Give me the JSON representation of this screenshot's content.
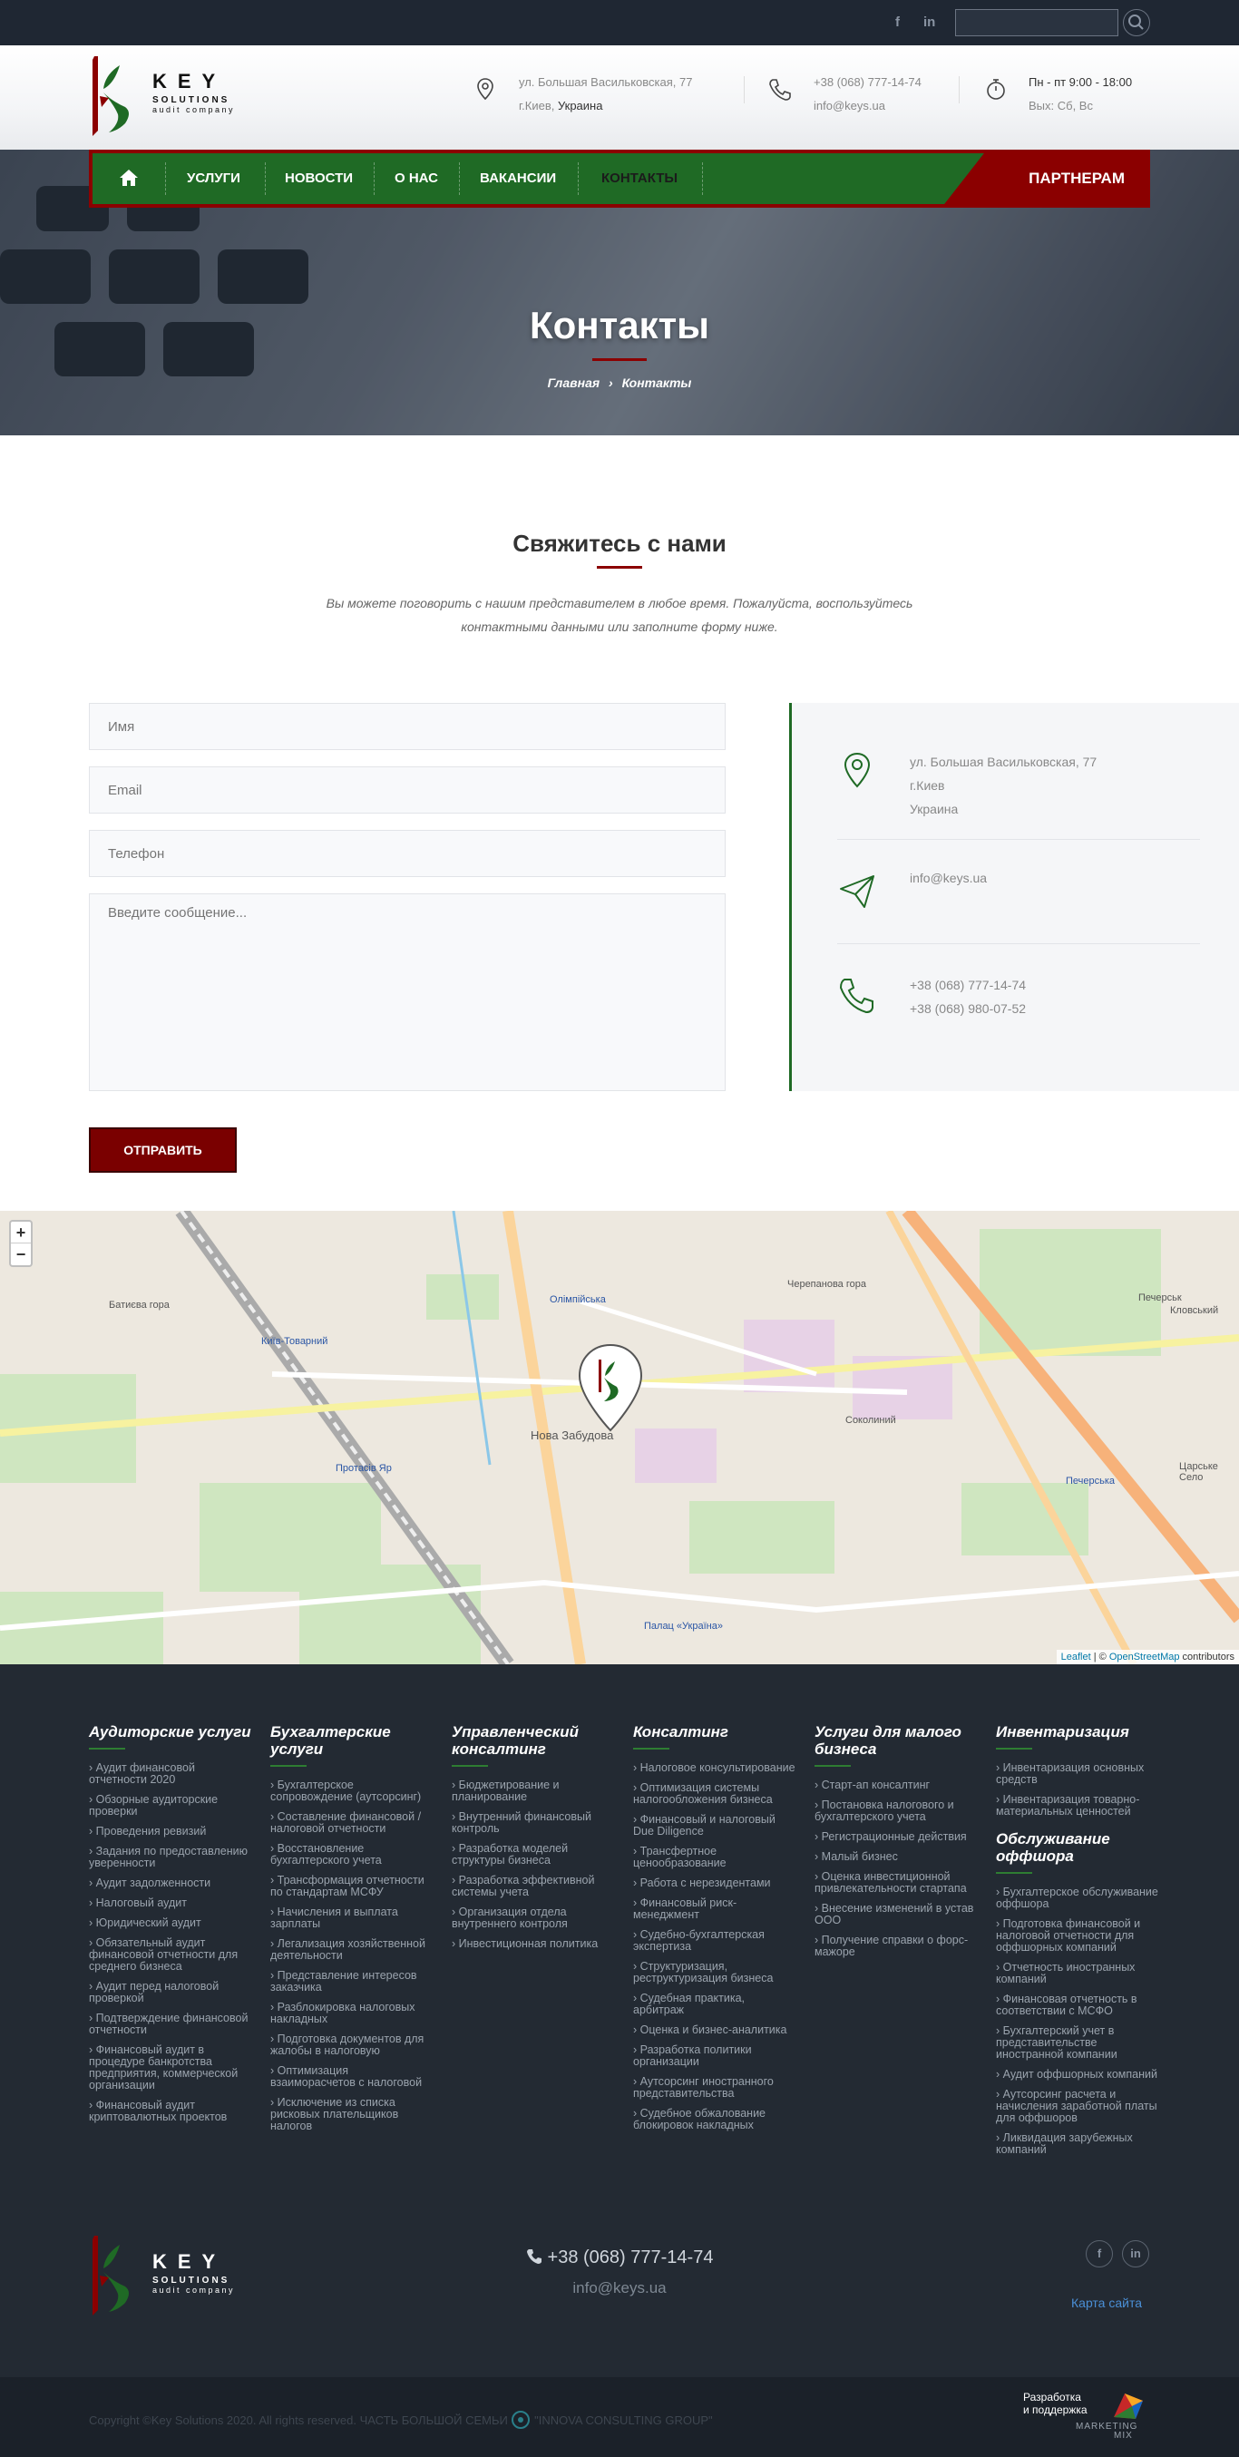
{
  "topbar": {
    "social": [
      "f",
      "in"
    ],
    "search_placeholder": ""
  },
  "logo": {
    "word": "KEY",
    "sub": "SOLUTIONS",
    "tag": "audit company"
  },
  "header": {
    "address_line1": "ул. Большая Васильковская, 77",
    "address_line2a": "г.Киев, ",
    "address_line2b": "Украина",
    "phone": "+38 (068) 777-14-74",
    "email": "info@keys.ua",
    "hours": "Пн - пт 9:00 - 18:00",
    "off": "Вых: Сб, Вс"
  },
  "nav": {
    "home_icon": "home-icon",
    "items": [
      "УСЛУГИ",
      "НОВОСТИ",
      "О НАС",
      "ВАКАНСИИ",
      "КОНТАКТЫ"
    ],
    "partner": "ПАРТНЕРАМ"
  },
  "hero": {
    "title": "Контакты",
    "crumb_home": "Главная",
    "crumb_sep": "›",
    "crumb_current": "Контакты"
  },
  "contact": {
    "title": "Свяжитесь с нами",
    "subtitle": "Вы можете поговорить с нашим представителем в любое время. Пожалуйста, воспользуйтесь контактными данными или заполните форму ниже."
  },
  "form": {
    "name_ph": "Имя",
    "email_ph": "Email",
    "phone_ph": "Телефон",
    "message_ph": "Введите сообщение...",
    "submit": "ОТПРАВИТЬ"
  },
  "info": {
    "addr1": "ул. Большая Васильковская, 77",
    "addr2": "г.Киев",
    "addr3": "Украина",
    "email": "info@keys.ua",
    "phone1": "+38 (068) 777-14-74",
    "phone2": "+38 (068) 980-07-52"
  },
  "map": {
    "zoom_in": "+",
    "zoom_out": "−",
    "labels": [
      "Батиєва гора",
      "Київ-Товарний",
      "Олімпійська",
      "Нова Забудова",
      "Протасів Яр",
      "Черепанова гора",
      "Печерськ",
      "Печерська",
      "Палац «Україна»",
      "Соколиний",
      "Царське Село",
      "Кловський"
    ],
    "attr_leaflet": "Leaflet",
    "attr_sep": " | © ",
    "attr_osm": "OpenStreetMap",
    "attr_tail": " contributors"
  },
  "footer": {
    "cols": [
      {
        "title": "Аудиторские услуги",
        "items": [
          "Аудит финансовой отчетности 2020",
          "Обзорные аудиторские проверки",
          "Проведения ревизий",
          "Задания по предоставлению уверенности",
          "Аудит задолженности",
          "Налоговый аудит",
          "Юридический аудит",
          "Обязательный аудит финансовой отчетности для среднего бизнеса",
          "Аудит перед налоговой проверкой",
          "Подтверждение финансовой отчетности",
          "Финансовый аудит в процедуре банкротства предприятия, коммерческой организации",
          "Финансовый аудит криптовалютных проектов"
        ]
      },
      {
        "title": "Бухгалтерские услуги",
        "items": [
          "Бухгалтерское сопровождение (аутсорсинг)",
          "Составление финансовой / налоговой отчетности",
          "Восстановление бухгалтерского учета",
          "Трансформация отчетности по стандартам МСФУ",
          "Начисления и выплата зарплаты",
          "Легализация хозяйственной деятельности",
          "Представление интересов заказчика",
          "Разблокировка налоговых накладных",
          "Подготовка документов для жалобы в налоговую",
          "Оптимизация взаиморасчетов с налоговой",
          "Исключение из списка рисковых плательщиков налогов"
        ]
      },
      {
        "title": "Управленческий консалтинг",
        "items": [
          "Бюджетирование и планирование",
          "Внутренний финансовый контроль",
          "Разработка моделей структуры бизнеса",
          "Разработка эффективной системы учета",
          "Организация отдела внутреннего контроля",
          "Инвестиционная политика"
        ]
      },
      {
        "title": "Консалтинг",
        "items": [
          "Налоговое консультирование",
          "Оптимизация системы налогообложения бизнеса",
          "Финансовый и налоговый Due Diligence",
          "Трансфертное ценообразование",
          "Работа с нерезидентами",
          "Финансовый риск-менеджмент",
          "Судебно-бухгалтерская экспертиза",
          "Структуризация, реструктуризация бизнеса",
          "Судебная практика, арбитраж",
          "Оценка и бизнес-аналитика",
          "Разработка политики организации",
          "Аутсорсинг иностранного представительства",
          "Судебное обжалование блокировок накладных"
        ]
      },
      {
        "title": "Услуги для малого бизнеса",
        "items": [
          "Старт-ап консалтинг",
          "Постановка налогового и бухгалтерского учета",
          "Регистрационные действия",
          "Малый бизнес",
          "Оценка инвестиционной привлекательности стартапа",
          "Внесение изменений в устав ООО",
          "Получение справки о форс-мажоре"
        ]
      },
      {
        "title": "Инвентаризация",
        "items": [
          "Инвентаризация основных средств",
          "Инвентаризация товарно-материальных ценностей"
        ]
      }
    ],
    "offshore": {
      "title": "Обслуживание оффшора",
      "items": [
        "Бухгалтерское обслуживание оффшора",
        "Подготовка финансовой и налоговой отчетности для оффшорных компаний",
        "Отчетность иностранных компаний",
        "Финансовая отчетность в соответствии с МСФО",
        "Бухгалтерский учет в представительстве иностранной компании",
        "Аудит оффшорных компаний",
        "Аутсорсинг расчета и начисления заработной платы для оффшоров",
        "Ликвидация зарубежных компаний"
      ]
    },
    "phone": "+38 (068) 777-14-74",
    "email": "info@keys.ua",
    "sitemap": "Карта сайта",
    "social": [
      "f",
      "in"
    ]
  },
  "bottom": {
    "copyright": "Copyright ©Key Solutions 2020. All rights reserved. ЧАСТЬ БОЛЬШОЙ СЕМЬИ ",
    "innova": "\"INNOVA CONSULTING GROUP\"",
    "dev1": "Разработка",
    "dev2": "и поддержка",
    "mm1": "MARKETING",
    "mm2": "MIX"
  },
  "colors": {
    "green": "#1f6a25",
    "red": "#8b0000",
    "footer": "#232a33"
  }
}
